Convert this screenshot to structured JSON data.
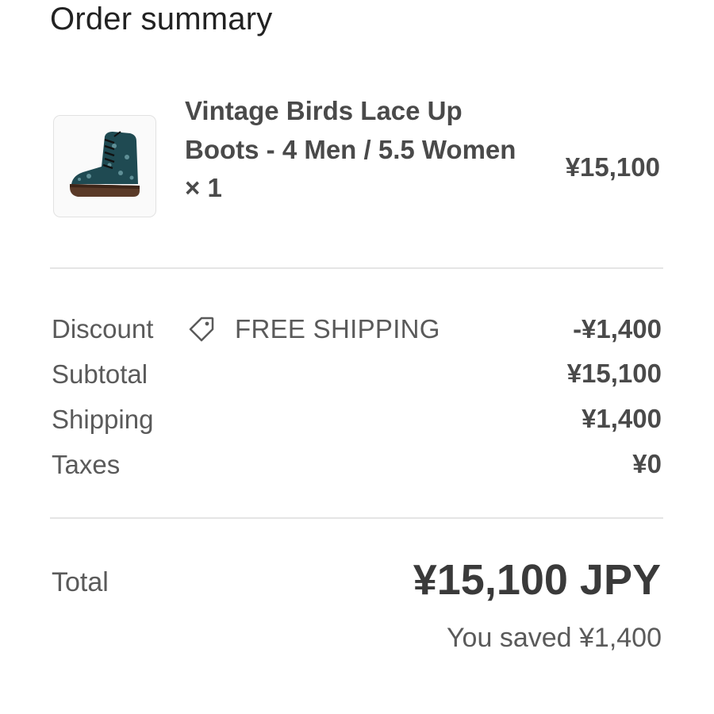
{
  "header": {
    "title": "Order summary"
  },
  "line_item": {
    "image_icon": "boot-product-image",
    "name": "Vintage Birds Lace Up Boots - 4 Men / 5.5 Women × 1",
    "price": "¥15,100"
  },
  "summary": {
    "discount": {
      "label": "Discount",
      "icon": "tag-icon",
      "code": "FREE SHIPPING",
      "value": "-¥1,400"
    },
    "subtotal": {
      "label": "Subtotal",
      "value": "¥15,100"
    },
    "shipping": {
      "label": "Shipping",
      "value": "¥1,400"
    },
    "taxes": {
      "label": "Taxes",
      "value": "¥0"
    }
  },
  "total": {
    "label": "Total",
    "value": "¥15,100 JPY",
    "saved": "You saved ¥1,400"
  }
}
